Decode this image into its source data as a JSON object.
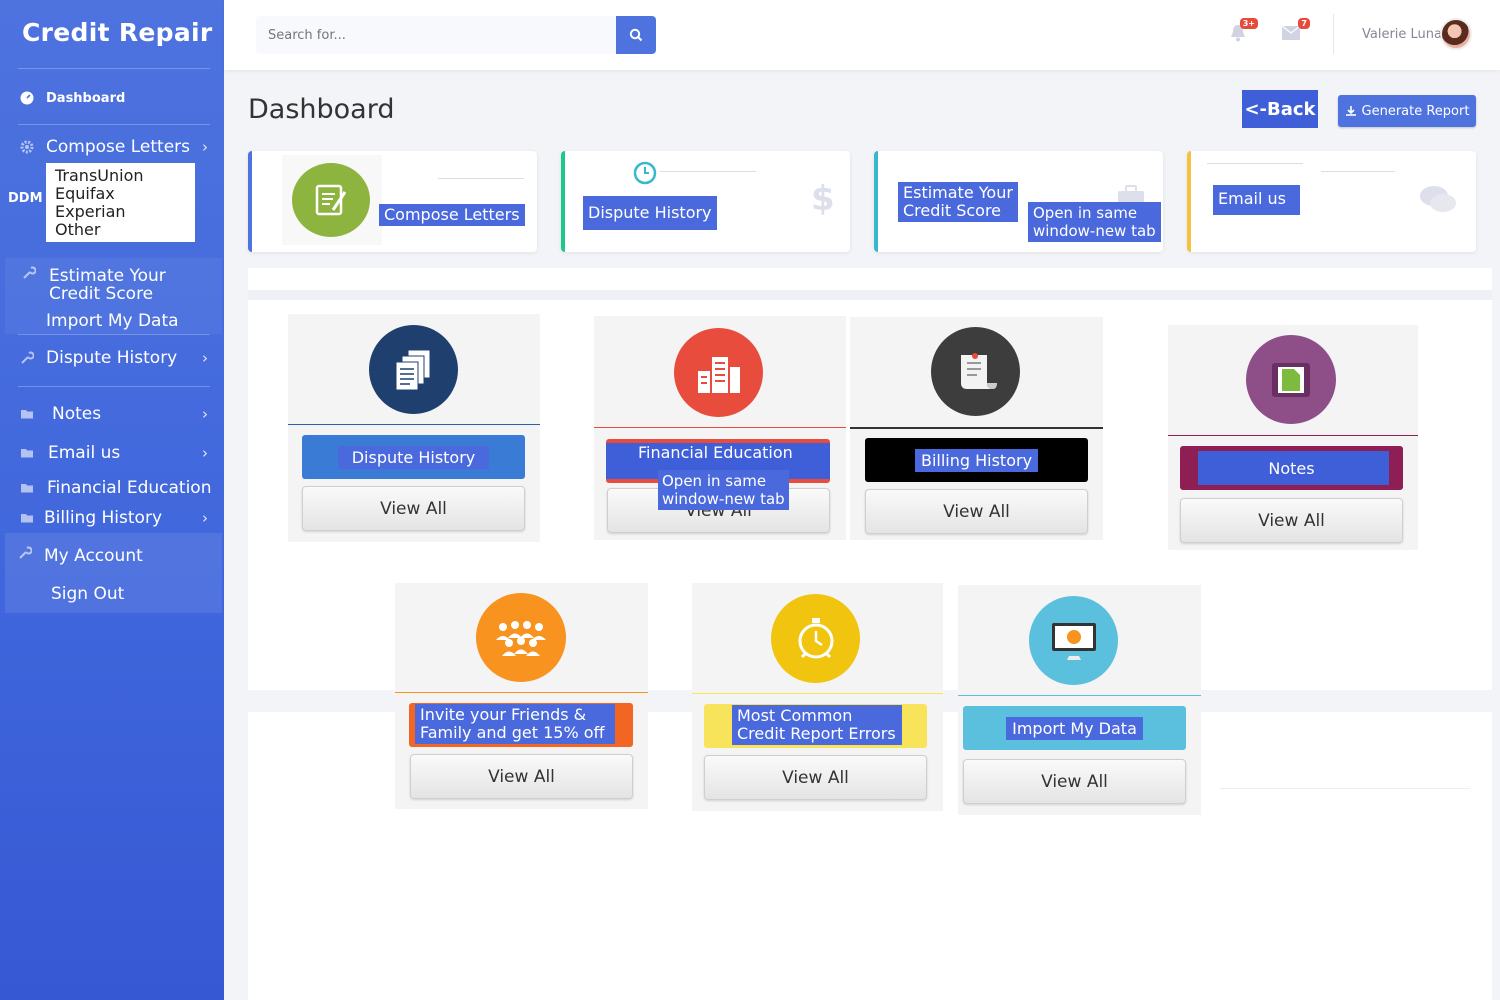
{
  "brand": "Credit Repair",
  "sidebar": {
    "dashboard": "Dashboard",
    "compose_letters": "Compose Letters",
    "ddm_label": "DDM",
    "ddm_options": [
      "TransUnion",
      "Equifax",
      "Experian",
      "Other"
    ],
    "estimate_line1": "Estimate Your",
    "estimate_line2": "Credit Score",
    "import_data": "Import My Data",
    "dispute_history": "Dispute History",
    "notes": "Notes",
    "email_us": "Email us",
    "financial_education": "Financial Education",
    "billing_history": "Billing History",
    "my_account": "My Account",
    "sign_out": "Sign Out"
  },
  "topbar": {
    "search_placeholder": "Search for...",
    "alerts_badge": "3+",
    "messages_badge": "7",
    "user_name": "Valerie Luna"
  },
  "page": {
    "title": "Dashboard",
    "back_label": "<-Back",
    "generate_label": "Generate Report"
  },
  "stat_cards": {
    "compose": "Compose Letters",
    "dispute": "Dispute History",
    "estimate_line1": "Estimate Your",
    "estimate_line2": "Credit Score",
    "estimate_note_line1": "Open in same",
    "estimate_note_line2": "window-new tab",
    "email": "Email us"
  },
  "tiles": {
    "dispute": {
      "label": "Dispute History",
      "view": "View All"
    },
    "financial": {
      "label": "Financial Education",
      "note_line1": "Open in same",
      "note_line2": "window-new tab",
      "view": "View All"
    },
    "billing": {
      "label": "Billing History",
      "view": "View All"
    },
    "notes": {
      "label": "Notes",
      "view": "View All"
    },
    "invite": {
      "label_line1": "Invite your Friends &",
      "label_line2": "Family and get 15% off",
      "view": "View All"
    },
    "errors": {
      "label_line1": "Most Common",
      "label_line2": "Credit Report Errors",
      "view": "View All"
    },
    "import": {
      "label": "Import My Data",
      "view": "View All"
    }
  },
  "colors": {
    "primary": "#4e73df",
    "dispute_blue": "#3a7bd5",
    "financial_red": "#e74c3c",
    "billing_black": "#000000",
    "notes_maroon": "#8e1f55",
    "invite_orange": "#f7931e",
    "errors_yellow": "#f7e45a",
    "import_cyan": "#5bc0de"
  }
}
